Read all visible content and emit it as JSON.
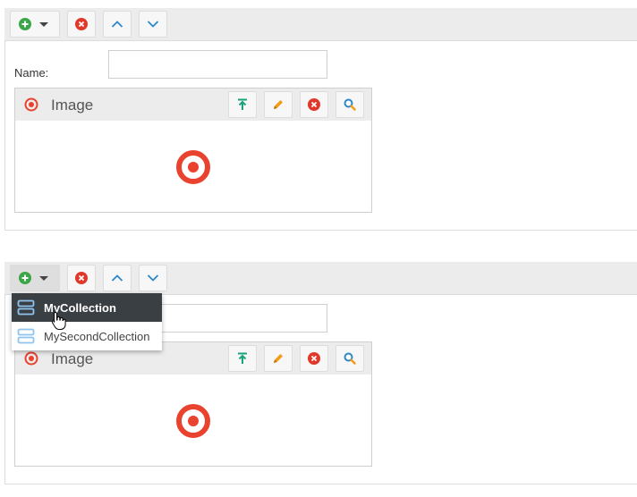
{
  "form_top": {
    "name_label": "Name:",
    "name_value": "",
    "image_title": "Image"
  },
  "form_bottom": {
    "name_value": "",
    "image_title": "Image"
  },
  "add_menu": {
    "items": [
      {
        "label": "MyCollection",
        "state": "hover"
      },
      {
        "label": "MySecondCollection",
        "state": "normal"
      }
    ]
  },
  "icons": {
    "add": "plus-circle-icon",
    "caret": "caret-down-icon",
    "delete": "x-circle-icon",
    "move_up": "chevron-up-icon",
    "move_down": "chevron-down-icon",
    "image": "target-icon",
    "upload": "upload-icon",
    "edit": "pencil-icon",
    "remove": "x-circle-icon",
    "zoom": "magnifier-icon",
    "collection": "collection-icon"
  },
  "colors": {
    "add_green": "#3aa648",
    "delete_red": "#e0392b",
    "chevron_blue": "#2c87c8",
    "upload_teal": "#1aa37a",
    "edit_orange": "#f29b14",
    "target_red": "#e9432f",
    "menu_hover_bg": "#3a3f44"
  }
}
